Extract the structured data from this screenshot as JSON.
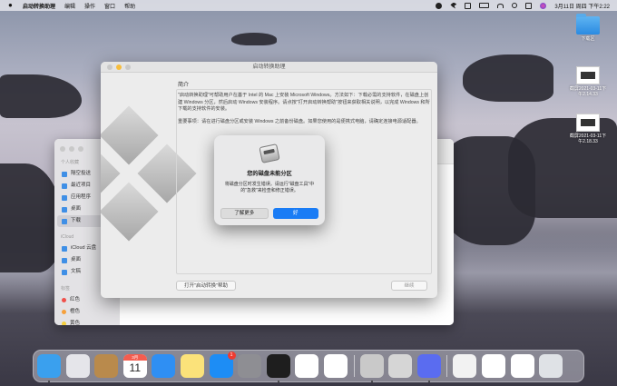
{
  "menubar": {
    "app_name": "启动转换助理",
    "menus": [
      "编辑",
      "操作",
      "窗口",
      "帮助"
    ],
    "clock": "3月11日 周四 下午2:22"
  },
  "desktop": {
    "items": [
      "下载区",
      "截屏2021-03-11下午2.14.33",
      "截屏2021-03-11下午2.18.33"
    ]
  },
  "finder": {
    "sections": [
      {
        "title": "个人收藏",
        "items": [
          "隔空投送",
          "最近项目",
          "应用程序",
          "桌面",
          "下载"
        ]
      },
      {
        "title": "iCloud",
        "items": [
          "iCloud 云盘",
          "桌面",
          "文稿"
        ]
      },
      {
        "title": "标签",
        "items": [
          "红色",
          "橙色",
          "黄色"
        ]
      }
    ],
    "selected": "下载",
    "tag_colors": [
      "#f0504a",
      "#f6a03b",
      "#f5cf3c"
    ]
  },
  "bootcamp": {
    "title": "启动转换助理",
    "section": "简介",
    "para1": "\"启动转换助理\"可帮助用户在基于 Intel 的 Mac 上安装 Microsoft Windows。方法如下：下载必需的支持软件，在磁盘上创建 Windows 分区，然后启动 Windows 安装程序。请点按\"打开启动转换帮助\"按钮来获取相关说明，以完成 Windows 和所下载的支持软件的安装。",
    "para2": "重要事项：请在进行磁盘分区或安装 Windows 之前备份磁盘。如果您使用的是便携式电脑，请确定连接电源适配器。",
    "help_button": "打开\"启动转换\"帮助",
    "continue_button": "继续"
  },
  "alert": {
    "title": "您的磁盘未能分区",
    "message": "将磁盘分区时发生错误。请运行\"磁盘工具\"中的\"急救\"来检查和修正错误。",
    "learn_more": "了解更多",
    "ok": "好"
  },
  "dock": {
    "apps": [
      {
        "icon": "finder-icon",
        "color": "#3aa0ee",
        "running": true
      },
      {
        "icon": "launchpad-icon",
        "color": "#e5e5ea",
        "running": false
      },
      {
        "icon": "contacts-icon",
        "color": "#b98a4c",
        "running": false
      },
      {
        "icon": "calendar-icon",
        "color": "#ffffff",
        "running": false
      },
      {
        "icon": "safari-icon",
        "color": "#2f8ff3",
        "running": false
      },
      {
        "icon": "notes-icon",
        "color": "#fbe27a",
        "running": false
      },
      {
        "icon": "app-store-icon",
        "color": "#1d8df5",
        "running": false,
        "badge": "1"
      },
      {
        "icon": "system-preferences-icon",
        "color": "#8e8e93",
        "running": false
      },
      {
        "icon": "qq-icon",
        "color": "#1e1e1e",
        "running": true
      },
      {
        "icon": "wps-icon",
        "color": "#ffffff",
        "running": false
      },
      {
        "icon": "baidu-netdisk-icon",
        "color": "#ffffff",
        "running": false
      },
      {
        "icon": "boot-camp-icon",
        "color": "#c9c9c9",
        "running": true
      },
      {
        "icon": "disk-utility-icon",
        "color": "#d6d6d6",
        "running": false
      },
      {
        "icon": "feishu-icon",
        "color": "#5a6cf0",
        "running": true
      },
      {
        "icon": "document-icon",
        "color": "#f2f2f2",
        "running": false
      },
      {
        "icon": "screenshot-icon",
        "color": "#ffffff",
        "running": false
      },
      {
        "icon": "image-stack-icon",
        "color": "#ffffff",
        "running": false
      },
      {
        "icon": "trash-icon",
        "color": "#dfe2e6",
        "running": false
      }
    ],
    "calendar_month": "3月",
    "calendar_day": "11"
  }
}
